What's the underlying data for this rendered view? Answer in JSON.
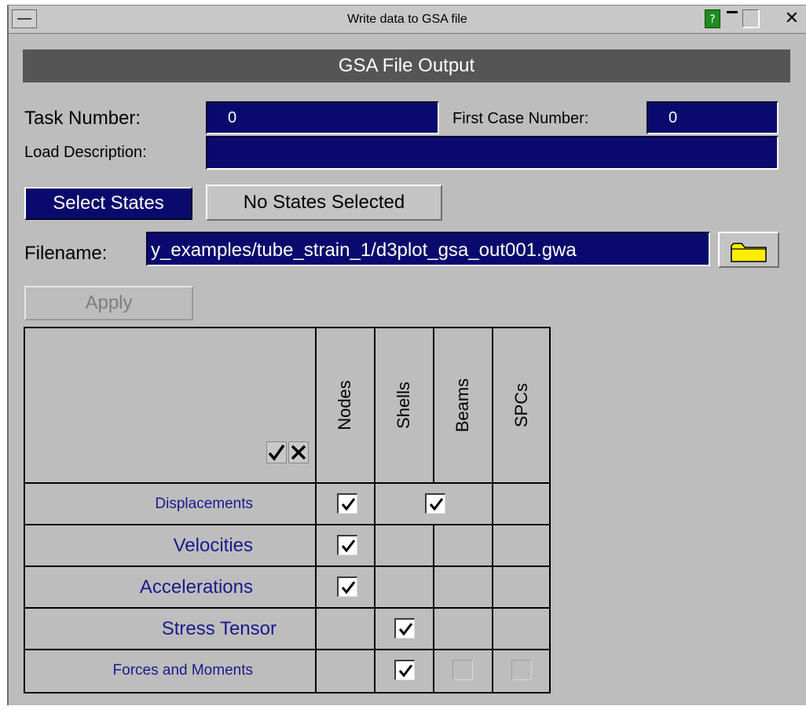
{
  "window": {
    "title": "Write data to GSA file"
  },
  "titlebar": {
    "help_label": "?"
  },
  "header": {
    "title": "GSA File Output"
  },
  "form": {
    "task_number_label": "Task Number:",
    "task_number_value": "0",
    "first_case_label": "First Case Number:",
    "first_case_value": "0",
    "load_description_label": "Load Description:",
    "load_description_value": "",
    "select_states_label": "Select States",
    "states_status": "No States Selected",
    "filename_label": "Filename:",
    "filename_value": "y_examples/tube_strain_1/d3plot_gsa_out001.gwa",
    "apply_label": "Apply"
  },
  "grid": {
    "columns": [
      "Nodes",
      "Shells",
      "Beams",
      "SPCs"
    ],
    "rows": [
      {
        "label": "Displacements",
        "nodes": true,
        "shells_beams": true
      },
      {
        "label": "Velocities",
        "nodes": true
      },
      {
        "label": "Accelerations",
        "nodes": true
      },
      {
        "label": "Stress Tensor",
        "shells": true
      },
      {
        "label": "Forces and Moments",
        "shells": true,
        "beams": false,
        "spcs": false
      }
    ]
  },
  "colors": {
    "field_bg": "#0a0a6e",
    "header_bg": "#555555",
    "panel_bg": "#bdbdbd",
    "row_label": "#1a1a8c",
    "folder_yellow": "#ffee00"
  }
}
